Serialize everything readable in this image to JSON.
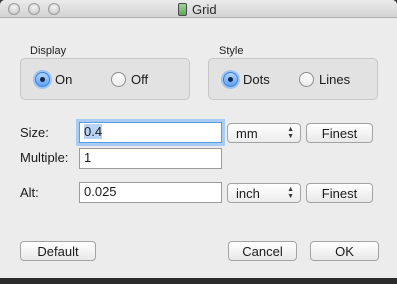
{
  "window": {
    "title": "Grid"
  },
  "display": {
    "label": "Display",
    "options": [
      {
        "label": "On",
        "selected": true
      },
      {
        "label": "Off",
        "selected": false
      }
    ]
  },
  "style": {
    "label": "Style",
    "options": [
      {
        "label": "Dots",
        "selected": true
      },
      {
        "label": "Lines",
        "selected": false
      }
    ]
  },
  "size": {
    "label": "Size:",
    "value": "0.4",
    "unit": "mm",
    "button": "Finest"
  },
  "multiple": {
    "label": "Multiple:",
    "value": "1"
  },
  "alt": {
    "label": "Alt:",
    "value": "0.025",
    "unit": "inch",
    "button": "Finest"
  },
  "buttons": {
    "default": "Default",
    "cancel": "Cancel",
    "ok": "OK"
  },
  "colors": {
    "accent": "#3a7fd9",
    "focus_ring": "#a9ccf4",
    "window_bg": "#ececec"
  }
}
